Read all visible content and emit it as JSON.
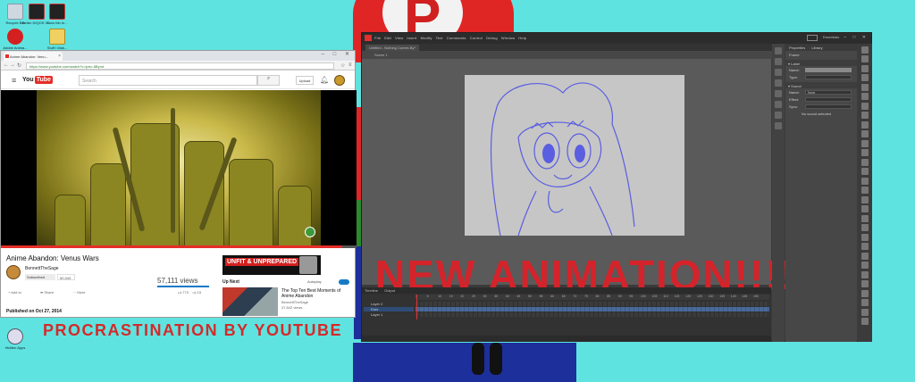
{
  "desktop": {
    "icons": [
      {
        "label": "Recycle Bin"
      },
      {
        "label": "Better DIQOS Vi..."
      },
      {
        "label": "Slow Mo In..."
      },
      {
        "label": "Adobe Anima..."
      },
      {
        "label": "Stuff I Mak..."
      },
      {
        "label": "Hidden Apps"
      }
    ],
    "caption": "PROCRASTINATION BY YOUTUBE"
  },
  "browser": {
    "tab_title": "Anime Abandon: Venu...",
    "url": "https://www.youtube.com/watch?v=lprrc-6Bynd",
    "window_controls": "– □ ✕"
  },
  "youtube": {
    "logo_you": "You",
    "logo_tube": "Tube",
    "search_placeholder": "Search",
    "upload_label": "Upload",
    "video_title": "Anime Abandon: Venus Wars",
    "channel_name": "BennettTheSage",
    "subscribe_label": "Subscribed",
    "subscriber_count": "50,343",
    "views": "57,111 views",
    "actions": {
      "add": "Add to",
      "share": "Share",
      "more": "More"
    },
    "likes": "773",
    "dislikes": "15",
    "published": "Published on Oct 27, 2014",
    "progress": 0.96,
    "banner_text": "UNFIT & UNPREPARED",
    "up_next_label": "Up Next",
    "autoplay_label": "Autoplay",
    "recommended": {
      "title": "The Top Ten Best Moments of Anime Abandon",
      "channel": "BennettTheSage",
      "views": "37,842 views"
    }
  },
  "animate": {
    "menu": [
      "File",
      "Edit",
      "View",
      "Insert",
      "Modify",
      "Text",
      "Commands",
      "Control",
      "Debug",
      "Window",
      "Help"
    ],
    "workspace": "Essentials",
    "doc_tab": "Untitled - Nothing Comes By*",
    "scene": "Scene 1",
    "overlay_text": "NEW ANIMATION!!!!!!!",
    "properties": {
      "tabs": [
        "Properties",
        "Library"
      ],
      "frame_label": "Frame",
      "label_section": "Label",
      "name_label": "Name:",
      "type_label": "Type:",
      "sound_section": "Sound",
      "sound_name_label": "Name:",
      "sound_name_value": "None",
      "effect_label": "Effect:",
      "sync_label": "Sync:",
      "note": "No sound selected"
    },
    "timeline": {
      "tabs": [
        "Timeline",
        "Output"
      ],
      "frame_numbers": [
        "1",
        "5",
        "10",
        "15",
        "20",
        "25",
        "30",
        "35",
        "40",
        "45",
        "50",
        "55",
        "60",
        "65",
        "70",
        "75",
        "80",
        "85",
        "90",
        "95",
        "100",
        "105",
        "110",
        "115",
        "120",
        "125",
        "130",
        "135",
        "140",
        "145",
        "150"
      ],
      "layers": [
        {
          "name": "Layer 2",
          "selected": false
        },
        {
          "name": "Ears",
          "selected": true
        },
        {
          "name": "Layer 1",
          "selected": false
        }
      ]
    }
  },
  "colors": {
    "wallpaper": "#5fe3e0",
    "youtube_red": "#e52d27",
    "overlay_red": "#d4232a",
    "sketch_line": "#5a5ee0",
    "animate_bg": "#3b3b3b"
  }
}
